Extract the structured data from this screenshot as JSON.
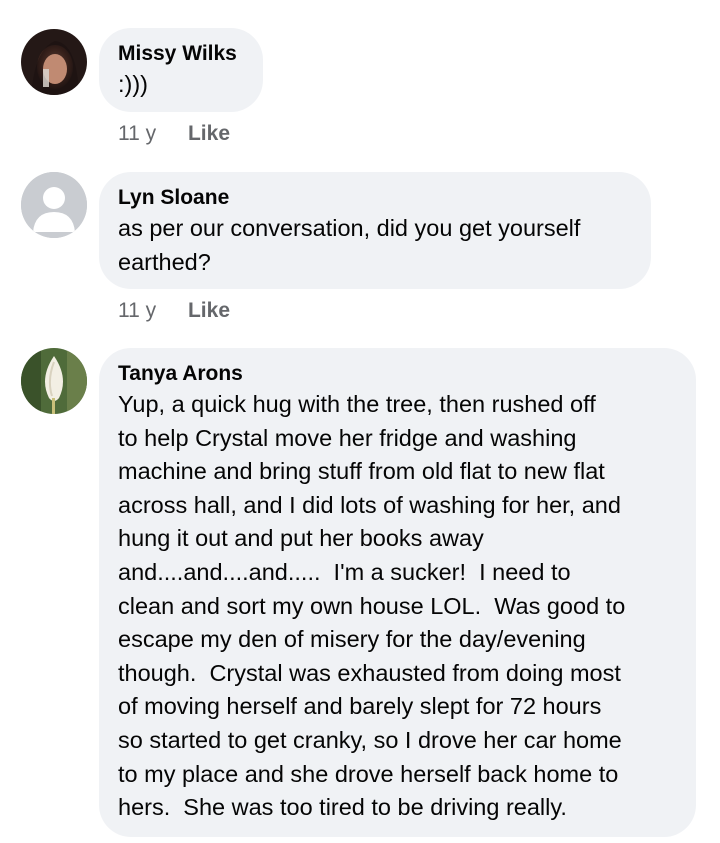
{
  "comments": [
    {
      "author": "Missy Wilks",
      "text": ":)))",
      "time": "11 y",
      "like_label": "Like"
    },
    {
      "author": "Lyn Sloane",
      "text": "as per our conversation, did you get yourself\nearthed?",
      "time": "11 y",
      "like_label": "Like"
    },
    {
      "author": "Tanya Arons",
      "text": "Yup, a quick hug with the tree, then rushed off\nto help Crystal move her fridge and washing\nmachine and bring stuff from old flat to new flat\nacross hall, and I did lots of washing for her, and\nhung it out and put her books away\nand....and....and.....  I'm a sucker!  I need to\nclean and sort my own house LOL.  Was good to\nescape my den of misery for the day/evening\nthough.  Crystal was exhausted from doing most\nof moving herself and barely slept for 72 hours\nso started to get cranky, so I drove her car home\nto my place and she drove herself back home to\nhers.  She was too tired to be driving really."
    }
  ],
  "colors": {
    "bubble": "#f0f2f5",
    "meta_text": "#65676b",
    "primary_text": "#050505"
  },
  "icons": {
    "avatar_default": "default-user-avatar-icon"
  }
}
